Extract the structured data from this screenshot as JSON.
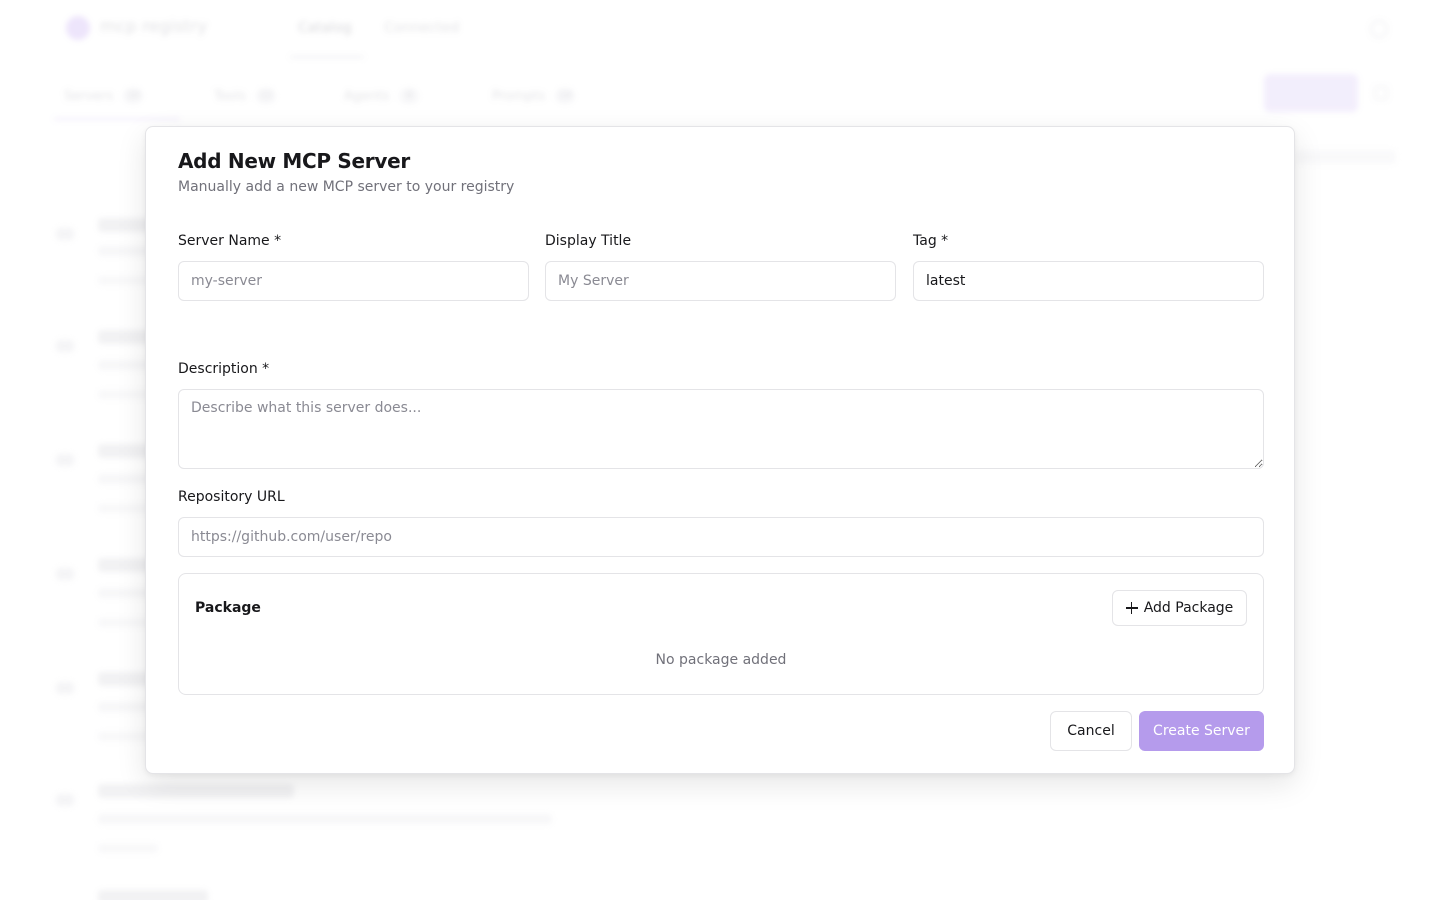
{
  "background": {
    "app_name": "mcp registry",
    "nav_tabs": [
      {
        "label": "Catalog"
      },
      {
        "label": "Connected"
      }
    ],
    "sub_tabs": [
      {
        "label": "Servers",
        "count": "10"
      },
      {
        "label": "Tools",
        "count": "12"
      },
      {
        "label": "Agents",
        "count": "8"
      },
      {
        "label": "Prompts",
        "count": "14"
      }
    ]
  },
  "modal": {
    "title": "Add New MCP Server",
    "description": "Manually add a new MCP server to your registry",
    "fields": {
      "server_name": {
        "label": "Server Name *",
        "placeholder": "my-server",
        "value": ""
      },
      "display_title": {
        "label": "Display Title",
        "placeholder": "My Server",
        "value": ""
      },
      "tag": {
        "label": "Tag *",
        "placeholder": "",
        "value": "latest"
      },
      "description": {
        "label": "Description *",
        "placeholder": "Describe what this server does...",
        "value": ""
      },
      "repository_url": {
        "label": "Repository URL",
        "placeholder": "https://github.com/user/repo",
        "value": ""
      }
    },
    "package": {
      "title": "Package",
      "add_label": "Add Package",
      "empty_text": "No package added"
    },
    "actions": {
      "cancel_label": "Cancel",
      "create_label": "Create Server"
    }
  },
  "colors": {
    "accent": "#b59bec",
    "border": "#e4e4e7",
    "muted_text": "#71717a"
  }
}
